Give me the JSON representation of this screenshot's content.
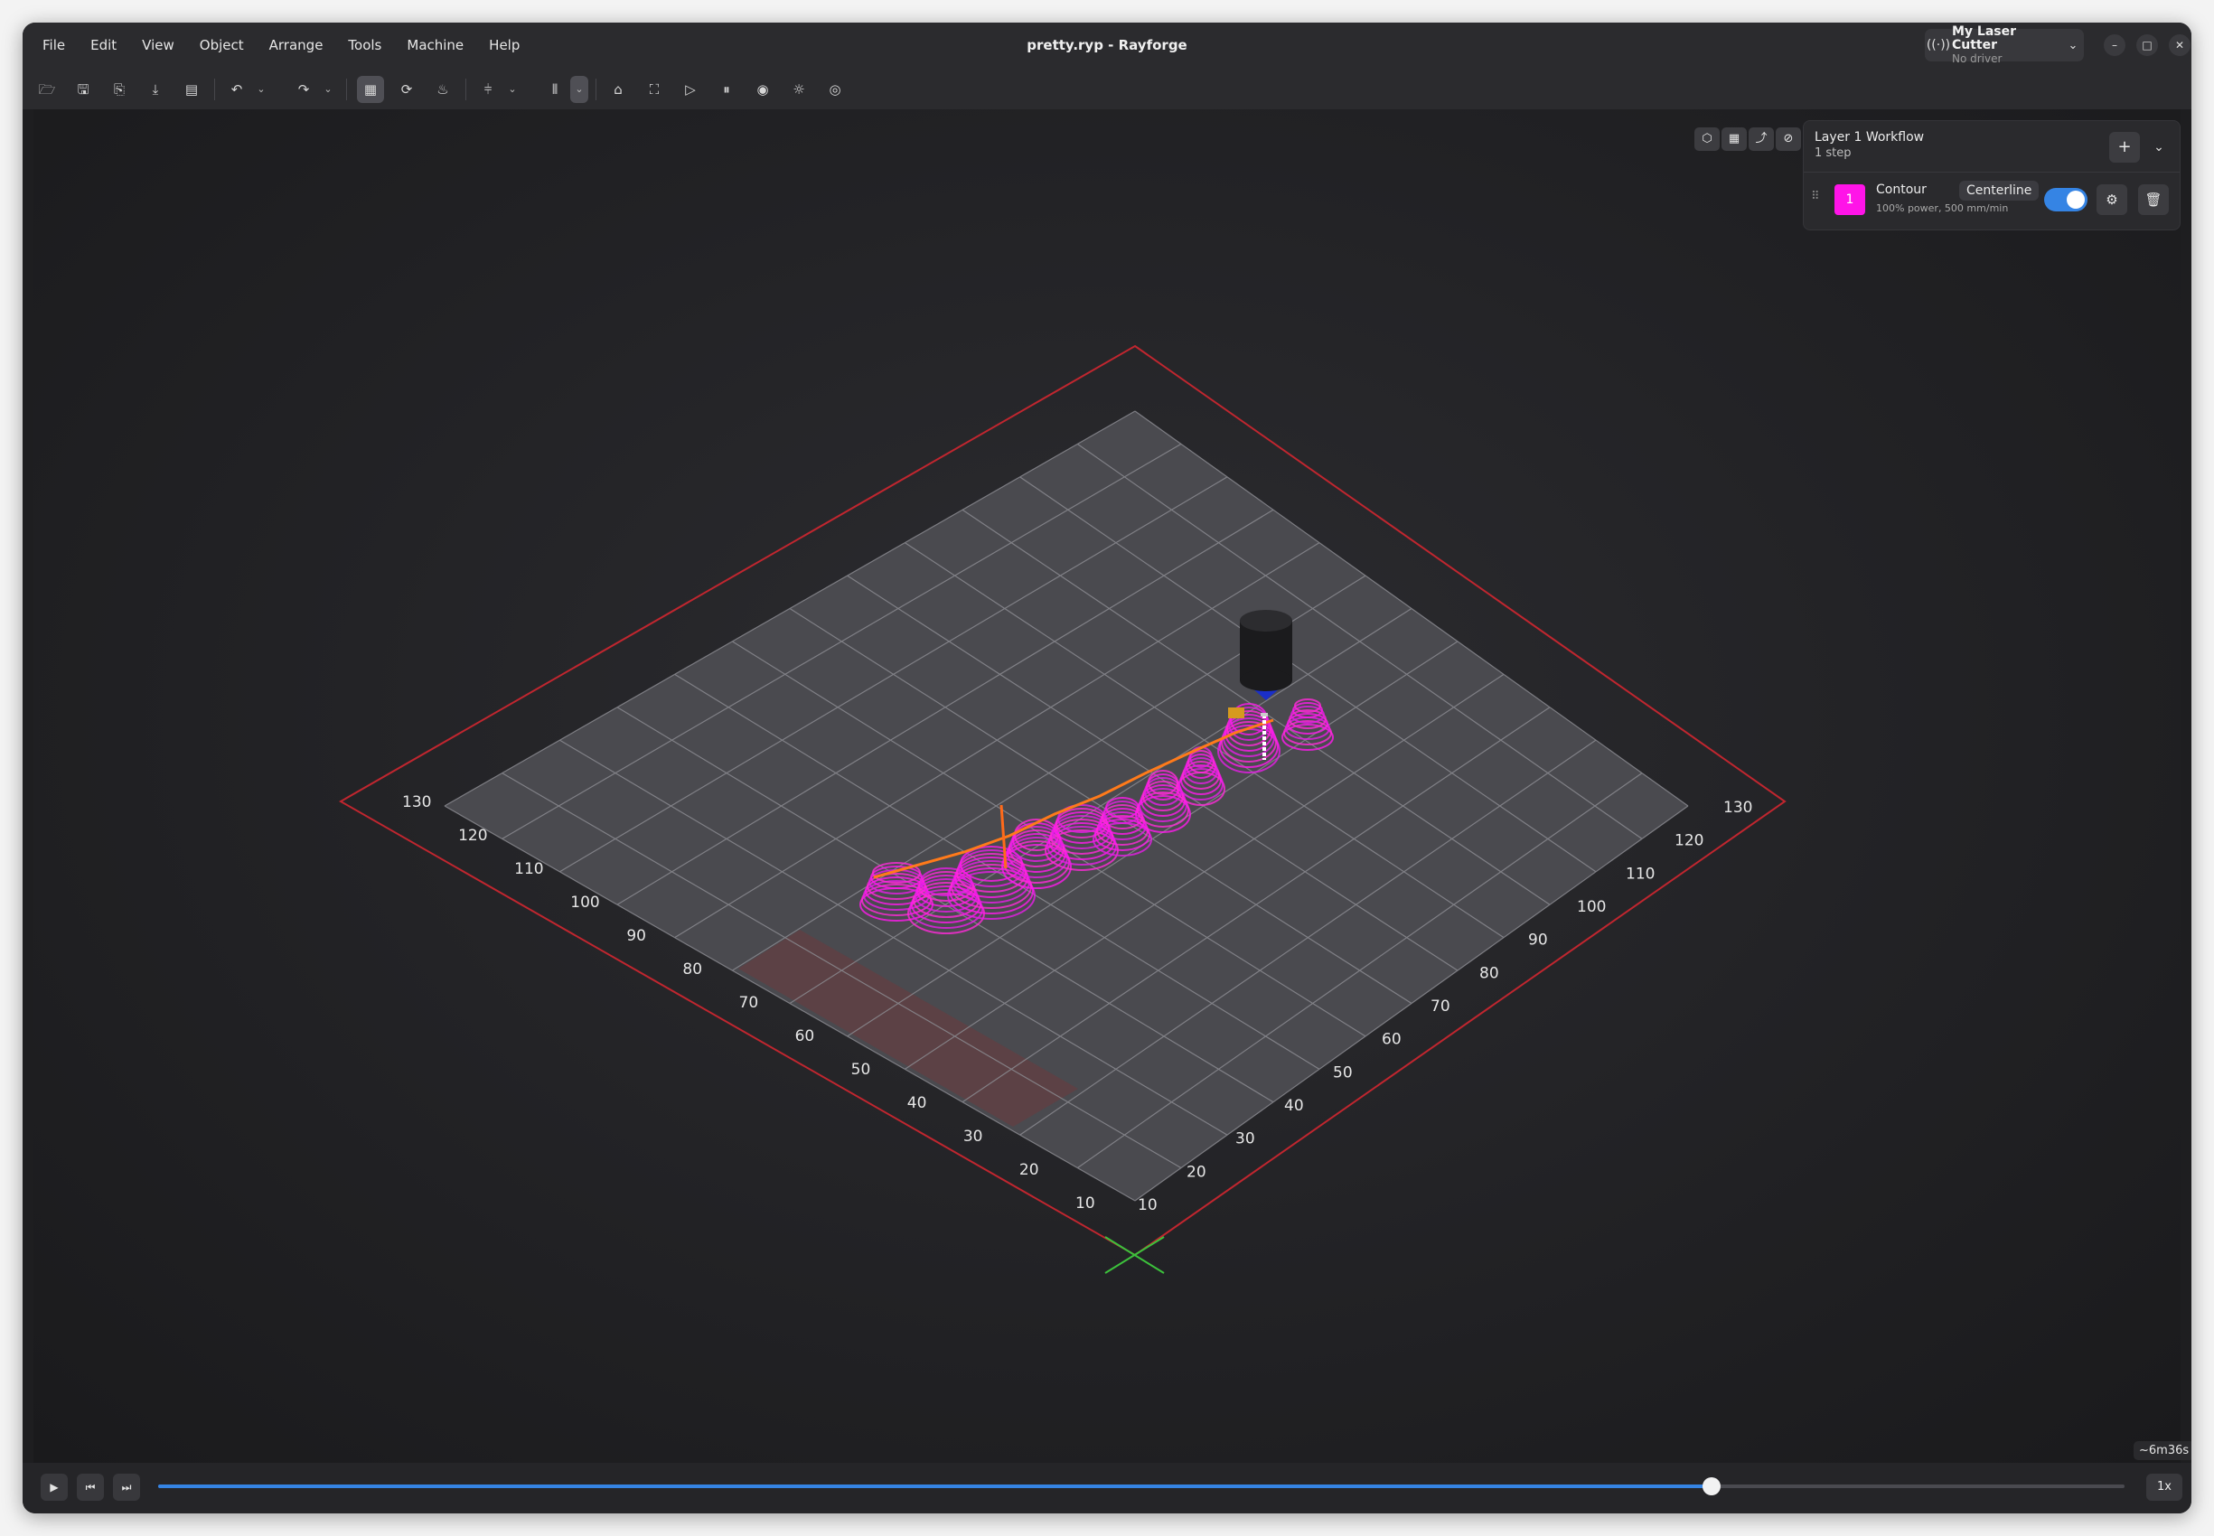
{
  "window": {
    "title": "pretty.ryp - Rayforge"
  },
  "menu": [
    "File",
    "Edit",
    "View",
    "Object",
    "Arrange",
    "Tools",
    "Machine",
    "Help"
  ],
  "machine": {
    "name": "My Laser Cutter",
    "status": "No driver"
  },
  "toolbar_icons": [
    "open-icon",
    "save-icon",
    "save-as-icon",
    "import-icon",
    "export-icon",
    "undo-icon",
    "redo-icon",
    "simulation-icon",
    "refresh-icon",
    "tool-icon",
    "align-icon",
    "distribute-icon",
    "home-icon",
    "frame-icon",
    "run-icon",
    "pause-icon",
    "record-icon",
    "focus-icon",
    "target-icon"
  ],
  "workflow": {
    "title": "Layer 1 Workflow",
    "subtitle": "1 step",
    "add_label": "+",
    "steps": [
      {
        "number": "1",
        "name": "Contour",
        "badge": "Centerline",
        "description": "100% power, 500 mm/min",
        "enabled": true,
        "color": "#ff14e8"
      }
    ]
  },
  "axis_labels": {
    "left": [
      "130",
      "120",
      "110",
      "100",
      "90",
      "80",
      "70",
      "60",
      "50",
      "40",
      "30",
      "20",
      "10"
    ],
    "right": [
      "130",
      "120",
      "110",
      "100",
      "90",
      "80",
      "70",
      "60",
      "50",
      "40",
      "30",
      "20",
      "10"
    ]
  },
  "playback": {
    "progress": 0.79,
    "speed": "1x",
    "estimated_time": "~6m36s"
  }
}
